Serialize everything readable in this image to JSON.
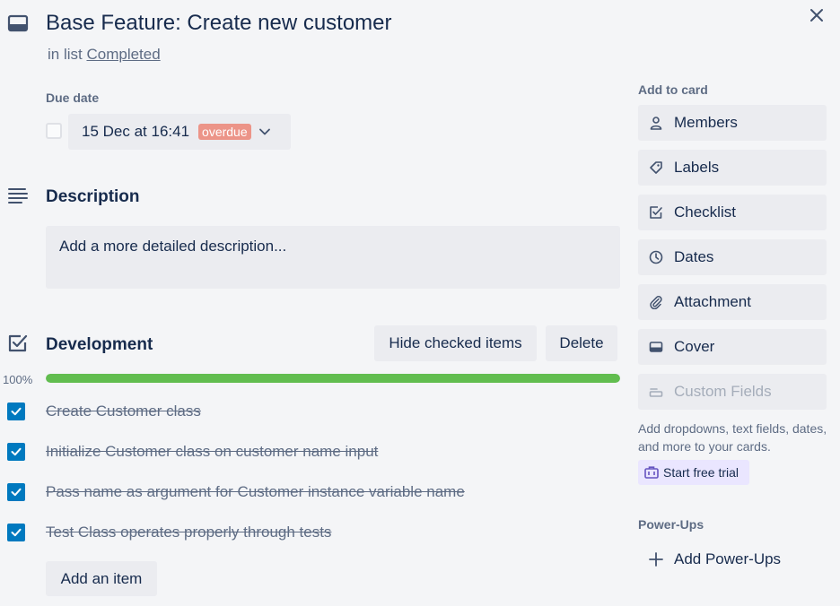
{
  "card": {
    "title": "Base Feature: Create new customer",
    "in_list_prefix": "in list",
    "list_name": "Completed"
  },
  "due": {
    "label": "Due date",
    "date_text": "15 Dec at 16:41",
    "status_badge": "overdue"
  },
  "description": {
    "title": "Description",
    "placeholder": "Add a more detailed description..."
  },
  "checklist": {
    "title": "Development",
    "hide_label": "Hide checked items",
    "delete_label": "Delete",
    "progress_text": "100%",
    "progress_fraction": 1.0,
    "items": [
      {
        "text": "Create Customer class",
        "checked": true
      },
      {
        "text": "Initialize Customer class on customer name input",
        "checked": true
      },
      {
        "text": "Pass name as argument for Customer instance variable name",
        "checked": true
      },
      {
        "text": "Test Class operates properly through tests",
        "checked": true
      }
    ],
    "add_item_label": "Add an item"
  },
  "sidebar": {
    "add_to_card_heading": "Add to card",
    "buttons": [
      {
        "label": "Members",
        "icon": "person-icon"
      },
      {
        "label": "Labels",
        "icon": "tag-icon"
      },
      {
        "label": "Checklist",
        "icon": "checkbox-icon"
      },
      {
        "label": "Dates",
        "icon": "clock-icon"
      },
      {
        "label": "Attachment",
        "icon": "paperclip-icon"
      },
      {
        "label": "Cover",
        "icon": "cover-icon"
      },
      {
        "label": "Custom Fields",
        "icon": "custom-fields-icon",
        "disabled": true
      }
    ],
    "promo_text": "Add dropdowns, text fields, dates, and more to your cards.",
    "trial_label": "Start free trial",
    "powerups_heading": "Power-Ups",
    "add_powerups_label": "Add Power-Ups"
  },
  "colors": {
    "accent_blue": "#0079bf",
    "progress_green": "#61bd4f",
    "overdue_red": "#ec9488",
    "trial_purple": "#eae6ff"
  }
}
